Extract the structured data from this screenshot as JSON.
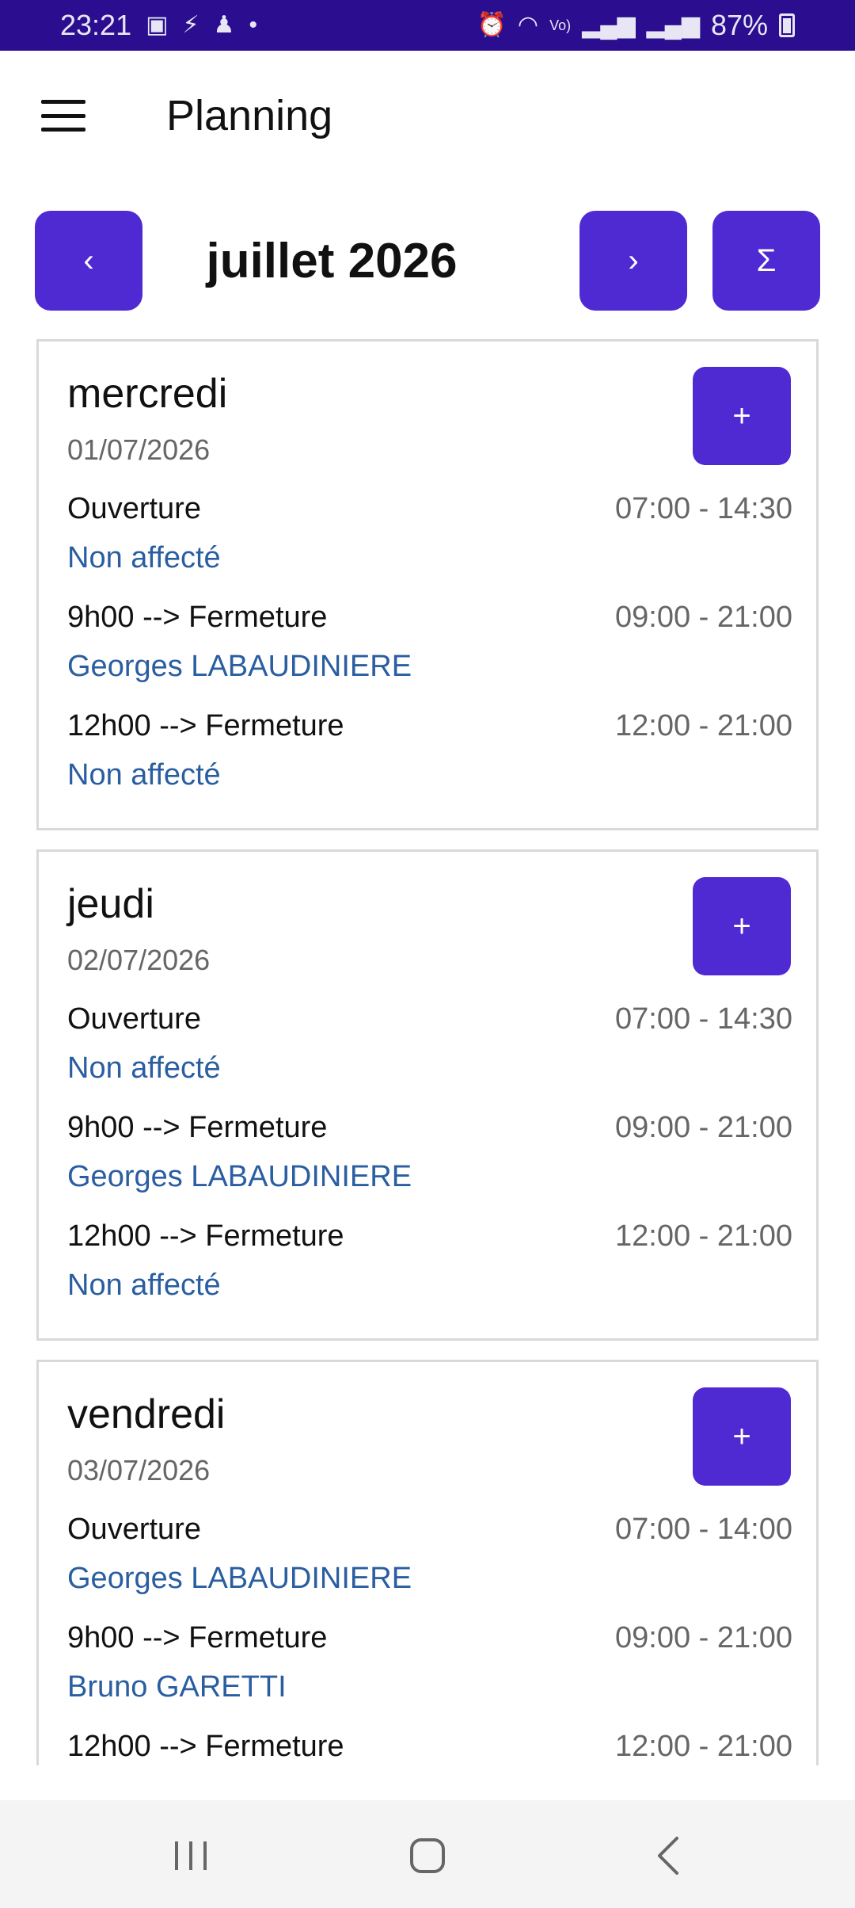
{
  "status_bar": {
    "time": "23:21",
    "battery": "87%",
    "icons_left": [
      "image-icon",
      "app-icon",
      "person-icon",
      "dot-icon"
    ],
    "icons_right": [
      "alarm-icon",
      "wifi-icon",
      "volte-icon",
      "signal-icon",
      "signal-icon",
      "battery-icon"
    ]
  },
  "app_bar": {
    "title": "Planning"
  },
  "month_nav": {
    "prev": "‹",
    "label": "juillet 2026",
    "next": "›",
    "sum": "Σ"
  },
  "days": [
    {
      "name": "mercredi",
      "date": "01/07/2026",
      "add": "+",
      "shifts": [
        {
          "name": "Ouverture",
          "time": "07:00 - 14:30",
          "assignee": "Non affecté"
        },
        {
          "name": "9h00 --> Fermeture",
          "time": "09:00 - 21:00",
          "assignee": "Georges LABAUDINIERE"
        },
        {
          "name": "12h00 --> Fermeture",
          "time": "12:00 - 21:00",
          "assignee": "Non affecté"
        }
      ]
    },
    {
      "name": "jeudi",
      "date": "02/07/2026",
      "add": "+",
      "shifts": [
        {
          "name": "Ouverture",
          "time": "07:00 - 14:30",
          "assignee": "Non affecté"
        },
        {
          "name": "9h00 --> Fermeture",
          "time": "09:00 - 21:00",
          "assignee": "Georges LABAUDINIERE"
        },
        {
          "name": "12h00 --> Fermeture",
          "time": "12:00 - 21:00",
          "assignee": "Non affecté"
        }
      ]
    },
    {
      "name": "vendredi",
      "date": "03/07/2026",
      "add": "+",
      "shifts": [
        {
          "name": "Ouverture",
          "time": "07:00 - 14:00",
          "assignee": "Georges LABAUDINIERE"
        },
        {
          "name": "9h00 --> Fermeture",
          "time": "09:00 - 21:00",
          "assignee": "Bruno GARETTI"
        },
        {
          "name": "12h00 --> Fermeture",
          "time": "12:00 - 21:00",
          "assignee": ""
        }
      ]
    }
  ],
  "bottom_nav": {
    "items": [
      "recents-icon",
      "home-icon",
      "back-icon"
    ]
  },
  "colors": {
    "status_bar": "#2a0e8f",
    "accent": "#4f2ad3",
    "assignee": "#2a5ea0"
  }
}
